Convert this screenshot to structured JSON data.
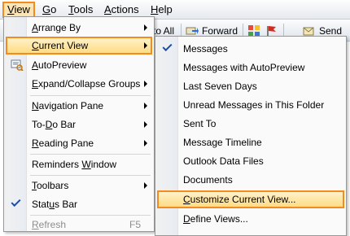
{
  "menubar": {
    "items": [
      {
        "label": "View",
        "u": "V",
        "rest": "iew"
      },
      {
        "label": "Go",
        "u": "G",
        "rest": "o"
      },
      {
        "label": "Tools",
        "u": "T",
        "rest": "ools"
      },
      {
        "label": "Actions",
        "u": "A",
        "rest": "ctions"
      },
      {
        "label": "Help",
        "u": "H",
        "rest": "elp"
      }
    ]
  },
  "toolbar": {
    "reply_all": "to All",
    "forward": "Forward",
    "send": "Send"
  },
  "view_menu": {
    "items": [
      {
        "pre": "",
        "u": "A",
        "post": "rrange By"
      },
      {
        "pre": "",
        "u": "C",
        "post": "urrent View"
      },
      {
        "pre": "",
        "u": "A",
        "post": "utoPreview"
      },
      {
        "pre": "",
        "u": "E",
        "post": "xpand/Collapse Groups"
      },
      {
        "pre": "",
        "u": "N",
        "post": "avigation Pane"
      },
      {
        "pre": "To-",
        "u": "D",
        "post": "o Bar"
      },
      {
        "pre": "",
        "u": "R",
        "post": "eading Pane"
      },
      {
        "pre": "Reminders ",
        "u": "W",
        "post": "indow"
      },
      {
        "pre": "",
        "u": "T",
        "post": "oolbars"
      },
      {
        "pre": "Stat",
        "u": "u",
        "post": "s Bar"
      },
      {
        "pre": "",
        "u": "R",
        "post": "efresh",
        "shortcut": "F5"
      }
    ]
  },
  "current_view_menu": {
    "items": [
      "Messages",
      "Messages with AutoPreview",
      "Last Seven Days",
      "Unread Messages in This Folder",
      "Sent To",
      "Message Timeline",
      "Outlook Data Files",
      "Documents"
    ],
    "customize": {
      "pre": "",
      "u": "C",
      "post": "ustomize Current View..."
    },
    "define": {
      "pre": "",
      "u": "D",
      "post": "efine Views..."
    }
  },
  "colors": {
    "accent_border": "#f28c1e",
    "highlight_fill": "#fedc84"
  }
}
